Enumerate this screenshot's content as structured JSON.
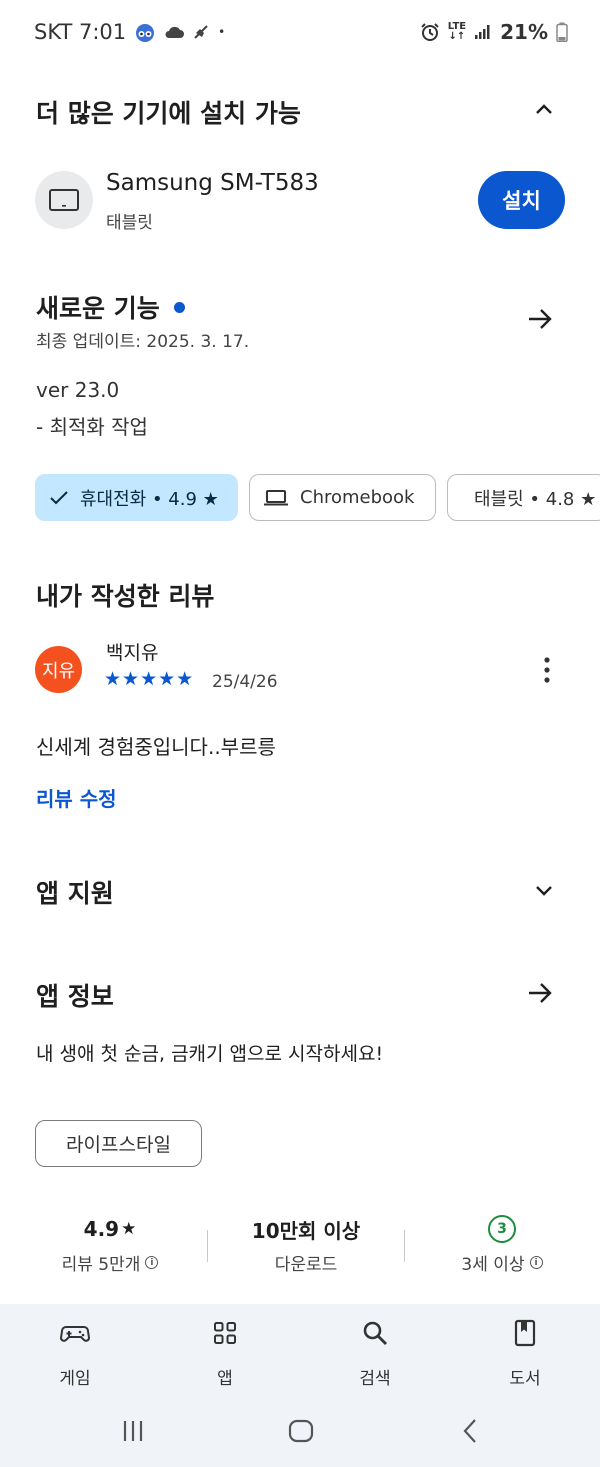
{
  "status_bar": {
    "carrier_time": "SKT 7:01",
    "network": "LTE",
    "battery": "21%"
  },
  "install_more": {
    "title": "더 많은 기기에 설치 가능",
    "device_name": "Samsung SM-T583",
    "device_type": "태블릿",
    "install_label": "설치"
  },
  "whats_new": {
    "title": "새로운 기능",
    "last_update": "최종 업데이트: 2025. 3. 17.",
    "version": "ver 23.0",
    "notes": "- 최적화 작업"
  },
  "device_chips": [
    {
      "label": "휴대전화 • 4.9 ★",
      "selected": true
    },
    {
      "label": "Chromebook",
      "selected": false
    },
    {
      "label": "태블릿 • 4.8 ★",
      "selected": false
    }
  ],
  "my_review": {
    "title": "내가 작성한 리뷰",
    "avatar_text": "지유",
    "reviewer": "백지유",
    "stars": "★★★★★",
    "rating": 5,
    "date": "25/4/26",
    "text": "신세계 경험중입니다..부르릉",
    "edit_label": "리뷰 수정"
  },
  "app_support": {
    "title": "앱 지원"
  },
  "app_info": {
    "title": "앱 정보",
    "description": "내 생애 첫 순금, 금캐기 앱으로 시작하세요!",
    "category": "라이프스타일"
  },
  "stats": {
    "rating_value": "4.9",
    "rating_star": "★",
    "rating_label": "리뷰 5만개",
    "downloads_value": "10만회 이상",
    "downloads_label": "다운로드",
    "age_badge": "3",
    "age_label": "3세 이상"
  },
  "bottom_nav": {
    "games": "게임",
    "apps": "앱",
    "search": "검색",
    "books": "도서"
  },
  "colors": {
    "accent": "#0b57d0",
    "chip_selected": "#c2e7ff",
    "avatar": "#f4511e",
    "age_badge": "#1e8e3e",
    "nav_bg": "#f0f4f9"
  }
}
